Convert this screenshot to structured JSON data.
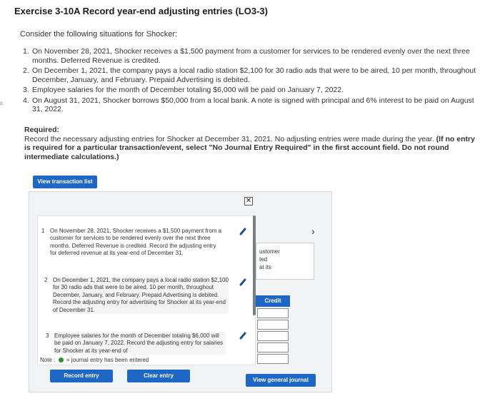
{
  "page": {
    "title": "Exercise 3-10A Record year-end adjusting entries (LO3-3)",
    "gutter_mark": "s"
  },
  "intro": "Consider the following situations for Shocker:",
  "situations": [
    {
      "num": "1.",
      "text": "On November 28, 2021, Shocker receives a $1,500 payment from a customer for services to be rendered evenly over the next three months. Deferred Revenue is credited."
    },
    {
      "num": "2.",
      "text": "On December 1, 2021, the company pays a local radio station $2,100 for 30 radio ads that were to be aired, 10 per month, throughout December, January, and February. Prepaid Advertising is debited."
    },
    {
      "num": "3.",
      "text": "Employee salaries for the month of December totaling $6,000 will be paid on January 7, 2022."
    },
    {
      "num": "4.",
      "text": "On August 31, 2021, Shocker borrows $50,000 from a local bank. A note is signed with principal and 6% interest to be paid on August 31, 2022."
    }
  ],
  "required": {
    "heading": "Required:",
    "text": "Record the necessary adjusting entries for Shocker at December 31, 2021. No adjusting entries were made during the year.",
    "bold_text": "(If no entry is required for a particular transaction/event, select \"No Journal Entry Required\" in the first account field. Do not round intermediate calculations.)"
  },
  "buttons": {
    "view_transaction_list": "View transaction list",
    "record_entry": "Record entry",
    "clear_entry": "Clear entry",
    "view_general_journal": "View general journal"
  },
  "modal": {
    "close": "✕",
    "transactions": [
      {
        "index": "1",
        "text": "On November 28, 2021, Shocker receives a $1,500 payment from a customer for services to be rendered evenly over the next three months. Deferred Revenue is credited. Record the adjusting entry for deferred revenue at its year-end of December 31."
      },
      {
        "index": "2",
        "text": "On December 1, 2021, the company pays a local radio station $2,100 for 30 radio ads that were to be aired, 10 per month, throughout December, January, and February. Prepaid Advertising is debited. Record the adjusting entry for advertising for Shocker at its year-end of December 31."
      },
      {
        "index": "3",
        "text": "Employee salaries for the month of December totaling $6,000 will be paid on January 7, 2022. Record the adjusting entry for salaries for Shocker at its year-end of"
      }
    ],
    "note_label": "Note :",
    "note_text": "= journal entry has been entered"
  },
  "side_card": {
    "line1": "ustomer",
    "line2": "ted",
    "line3": "at its"
  },
  "journal": {
    "credit_header": "Credit",
    "chevron": "›"
  },
  "colors": {
    "accent_blue": "#1e67c4",
    "entered_dot_green": "#2f8f2f",
    "panel_bg": "#f1f3f5"
  },
  "icons": {
    "close": "close-icon",
    "edit": "pencil-icon",
    "next": "chevron-right-icon"
  }
}
